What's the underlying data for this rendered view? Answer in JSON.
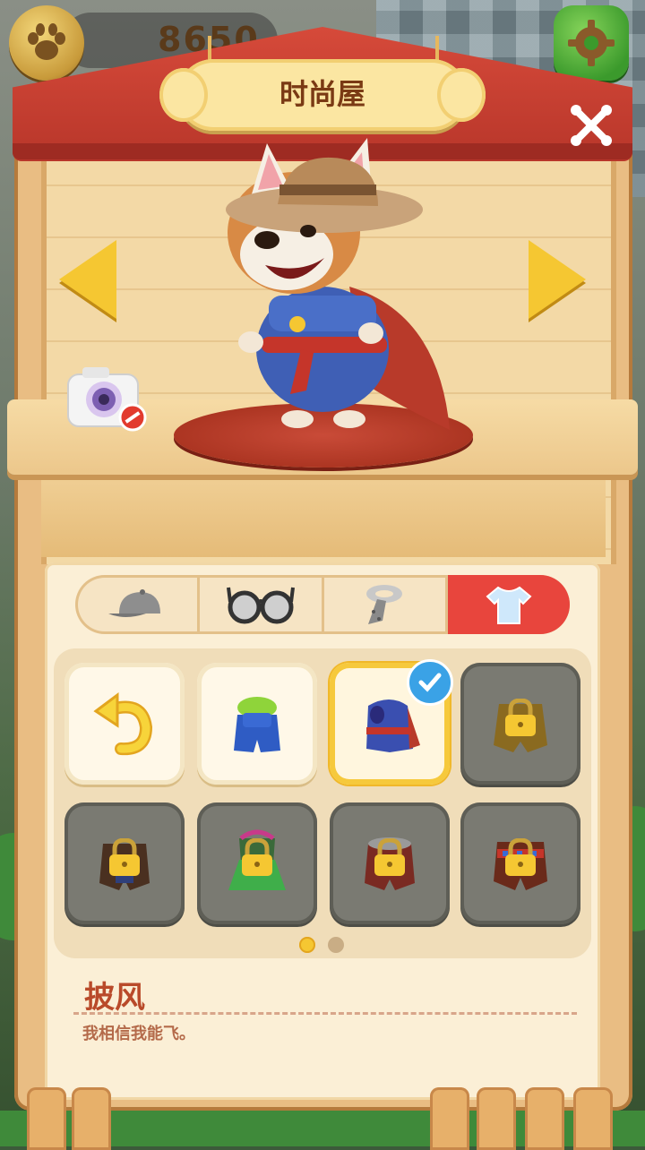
{
  "hud": {
    "coins": "8650",
    "paw_icon": "paw-icon",
    "gear_icon": "gear-icon"
  },
  "shop": {
    "title": "时尚屋",
    "close_icon": "close-icon"
  },
  "preview": {
    "camera_icon": "camera-icon",
    "left_arrow": "arrow-left-icon",
    "right_arrow": "arrow-right-icon"
  },
  "tabs": [
    {
      "name": "hat",
      "icon": "cap-icon",
      "active": false
    },
    {
      "name": "glasses",
      "icon": "glasses-icon",
      "active": false
    },
    {
      "name": "scarf",
      "icon": "scarf-icon",
      "active": false
    },
    {
      "name": "shirt",
      "icon": "shirt-icon",
      "active": true
    }
  ],
  "items": [
    {
      "id": "reset",
      "icon": "undo-icon",
      "locked": false,
      "selected": false
    },
    {
      "id": "overalls-green",
      "icon": "overalls-icon",
      "locked": false,
      "selected": false
    },
    {
      "id": "cape",
      "icon": "cape-icon",
      "locked": false,
      "selected": true
    },
    {
      "id": "jacket",
      "icon": "jacket-icon",
      "locked": true,
      "selected": false
    },
    {
      "id": "coat-brown",
      "icon": "coat-icon",
      "locked": true,
      "selected": false
    },
    {
      "id": "grass-skirt",
      "icon": "grass-skirt-icon",
      "locked": true,
      "selected": false
    },
    {
      "id": "coat-red",
      "icon": "coat-icon",
      "locked": true,
      "selected": false
    },
    {
      "id": "poncho",
      "icon": "poncho-icon",
      "locked": true,
      "selected": false
    }
  ],
  "pagination": {
    "pages": 2,
    "current": 1
  },
  "description": {
    "name": "披风",
    "text": "我相信我能飞。"
  },
  "colors": {
    "accent_red": "#e8453d",
    "gold": "#f5c732",
    "wood": "#e9bd83"
  }
}
